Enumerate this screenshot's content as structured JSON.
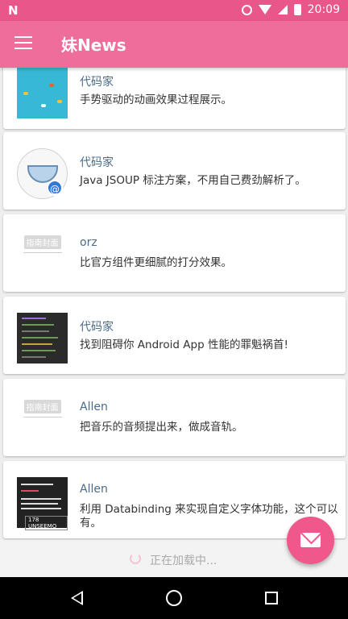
{
  "status_bar": {
    "time": "20:09",
    "left_icon": "N",
    "icons": [
      "alarm-icon",
      "wifi-off-icon",
      "signal-icon",
      "battery-charging-icon"
    ]
  },
  "app_bar": {
    "title": "妹News",
    "menu_icon": "hamburger-menu-icon"
  },
  "articles": [
    {
      "author": "代码家",
      "desc": "手势驱动的动画效果过程展示。",
      "thumb": "sea-game-thumbnail"
    },
    {
      "author": "代码家",
      "desc": "Java JSOUP 标注方案，不用自己费劲解析了。",
      "thumb": "bowl-at-logo-thumbnail"
    },
    {
      "author": "orz",
      "desc": "比官方组件更细腻的打分效果。",
      "thumb": "guide-cover-placeholder",
      "thumb_label": "指南封面"
    },
    {
      "author": "代码家",
      "desc": "找到阻碍你 Android App 性能的罪魁祸首!",
      "thumb": "code-screenshot-thumbnail"
    },
    {
      "author": "Allen",
      "desc": "把音乐的音频提出来，做成音轨。",
      "thumb": "guide-cover-placeholder",
      "thumb_label": "指南封面"
    },
    {
      "author": "Allen",
      "desc": "利用 Databinding 来实现自定义字体功能，这个可以有。",
      "thumb": "font-demo-thumbnail",
      "thumb_label": "178 UNSEEMO"
    }
  ],
  "loading": {
    "text": "正在加载中..."
  },
  "fab": {
    "icon": "email-icon"
  },
  "nav_bar": {
    "icons": [
      "back-icon",
      "home-icon",
      "recents-icon"
    ]
  },
  "colors": {
    "status_bar": "#e9578a",
    "app_bar": "#ef6d9b",
    "fab": "#f0588c",
    "author_text": "#4a6b8a"
  }
}
